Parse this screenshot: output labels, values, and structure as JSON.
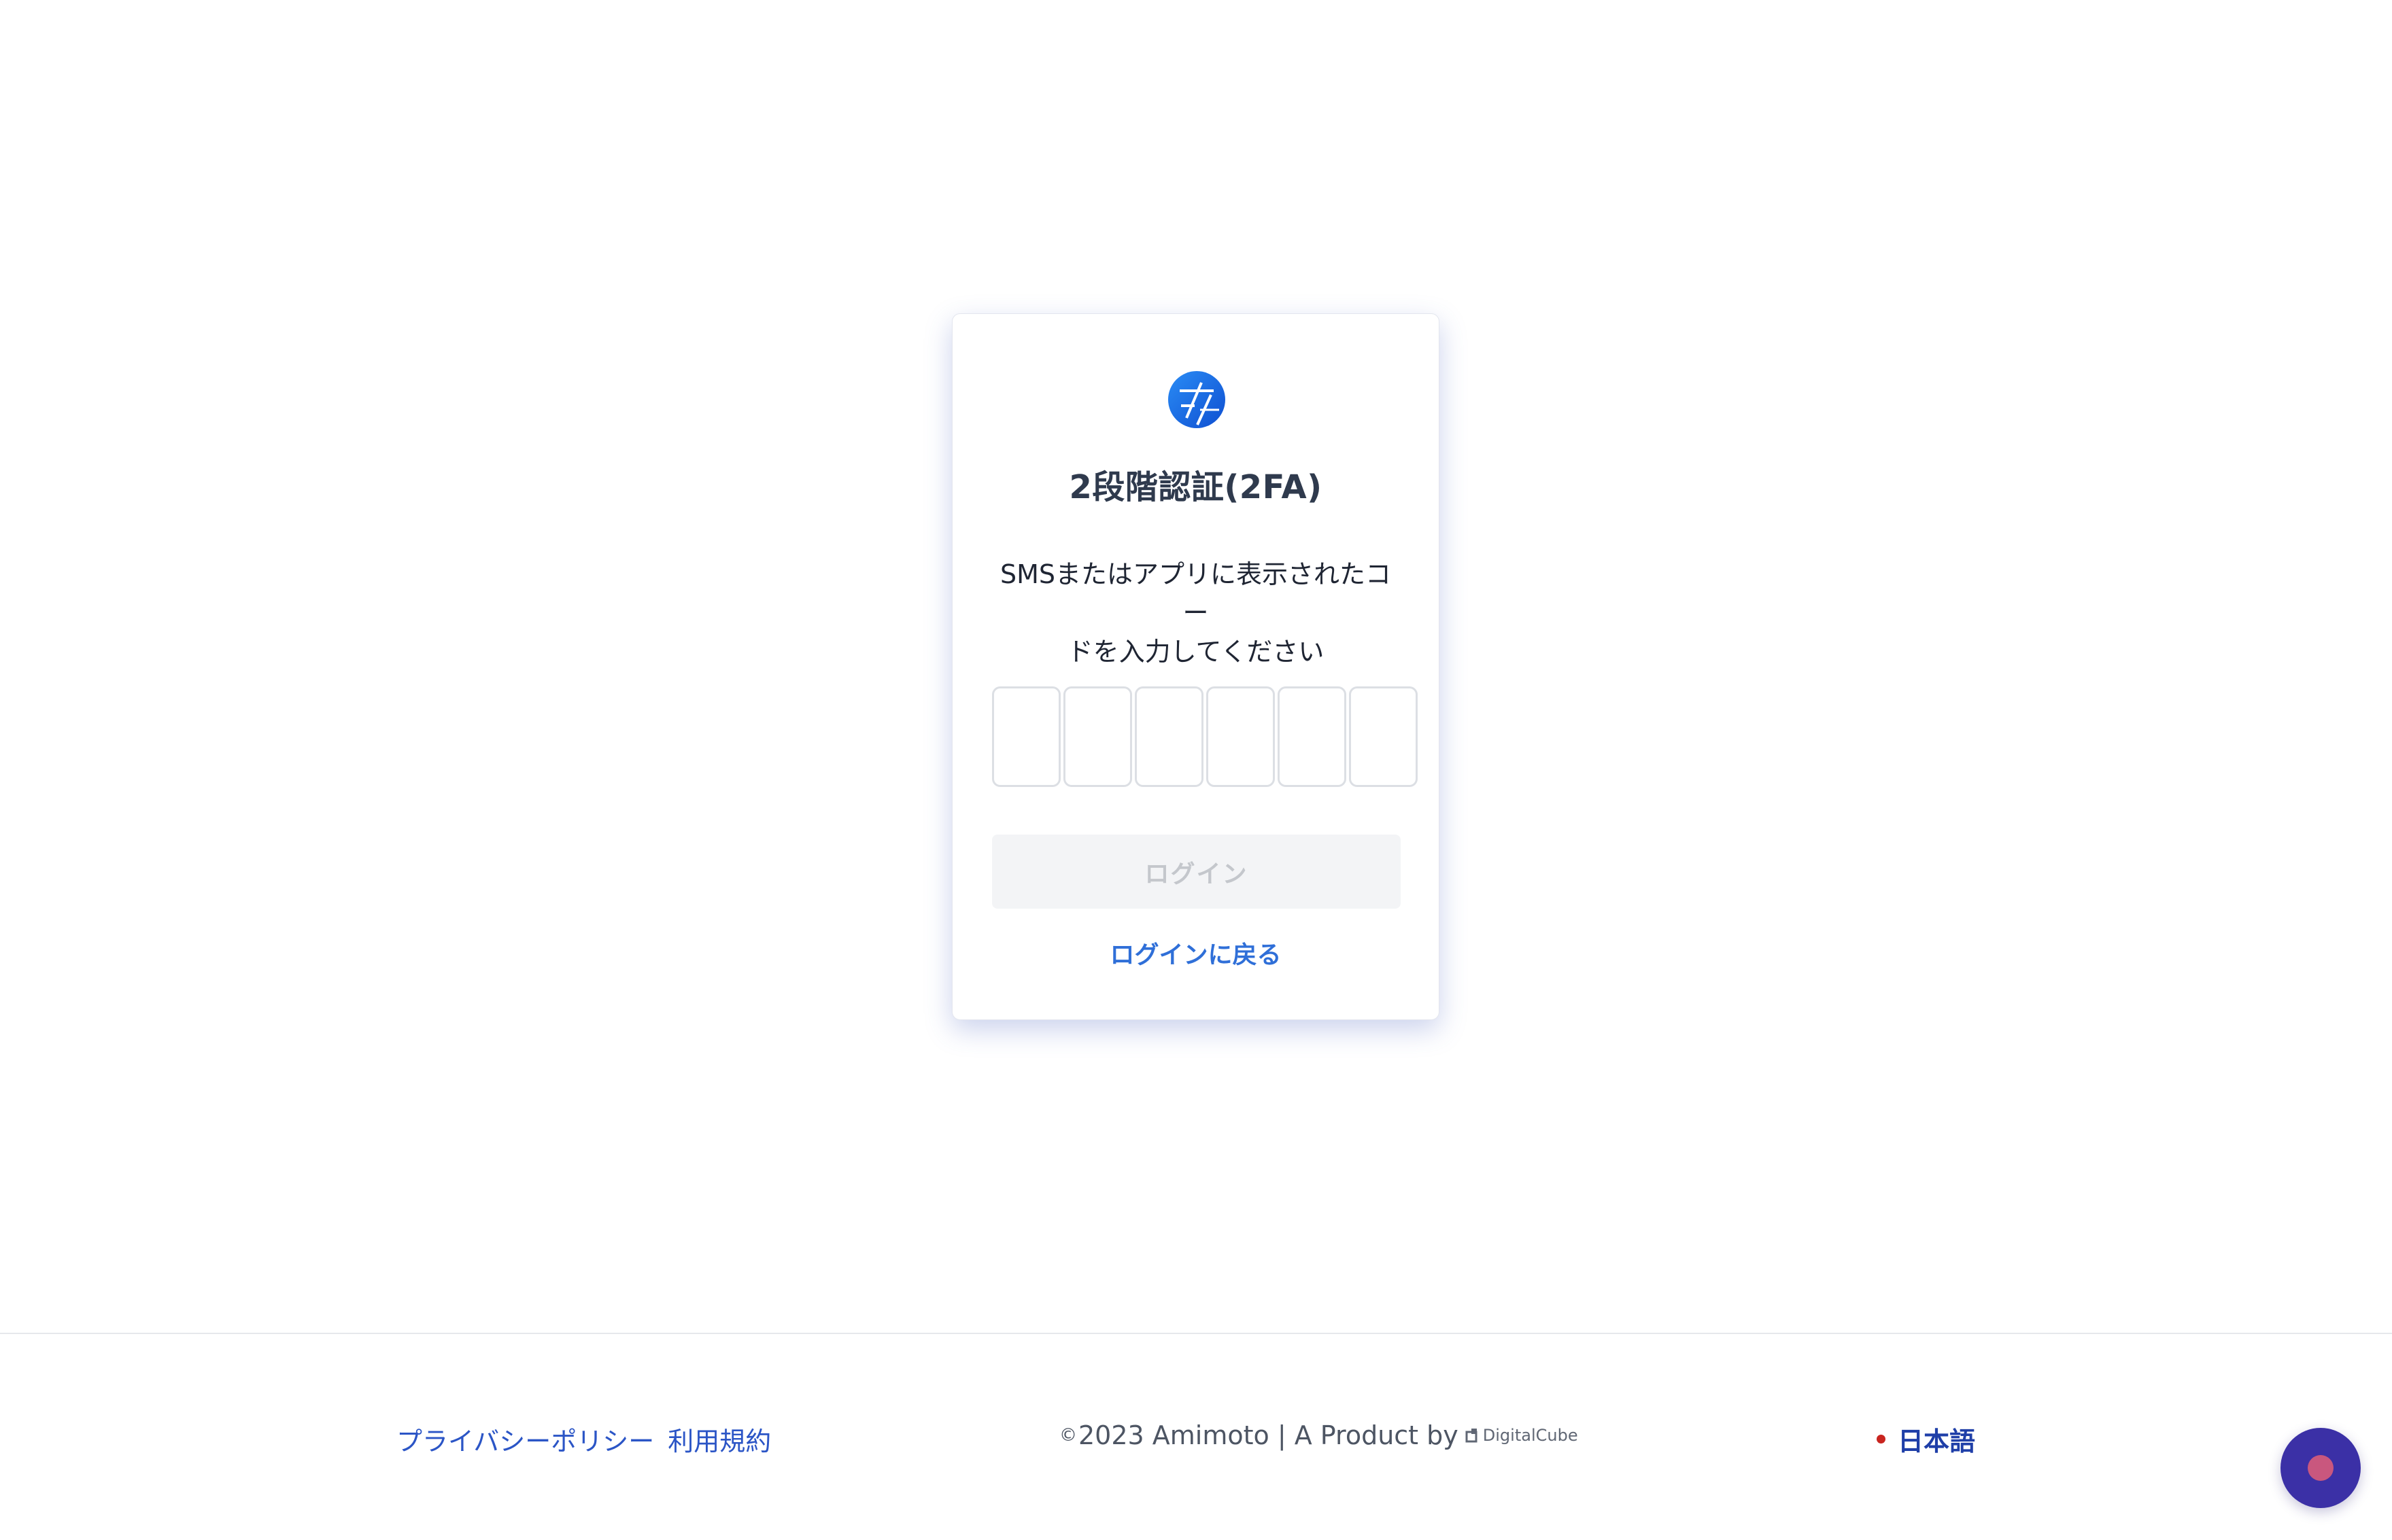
{
  "card": {
    "title": "2段階認証(2FA)",
    "description_line1": "SMSまたはアプリに表示されたコー",
    "description_line2": "ドを入力してください",
    "otp": {
      "length": 6,
      "values": [
        "",
        "",
        "",
        "",
        "",
        ""
      ]
    },
    "login_button_label": "ログイン",
    "back_link_label": "ログインに戻る"
  },
  "footer": {
    "links": [
      {
        "label": "プライバシーポリシー"
      },
      {
        "label": "利用規約"
      }
    ],
    "copyright_sign": "©",
    "copyright_text": "2023 Amimoto | A Product by",
    "vendor_name": "DigitalCube",
    "language": "日本語"
  },
  "icons": {
    "logo": "amimoto-logo-icon",
    "vendor": "digitalcube-logo-icon",
    "chat": "chat-icon"
  },
  "colors": {
    "brand_blue": "#1468e6",
    "link_blue": "#2f6fd8",
    "footer_link": "#2b55c6",
    "chat_bg": "#3b30a6"
  }
}
